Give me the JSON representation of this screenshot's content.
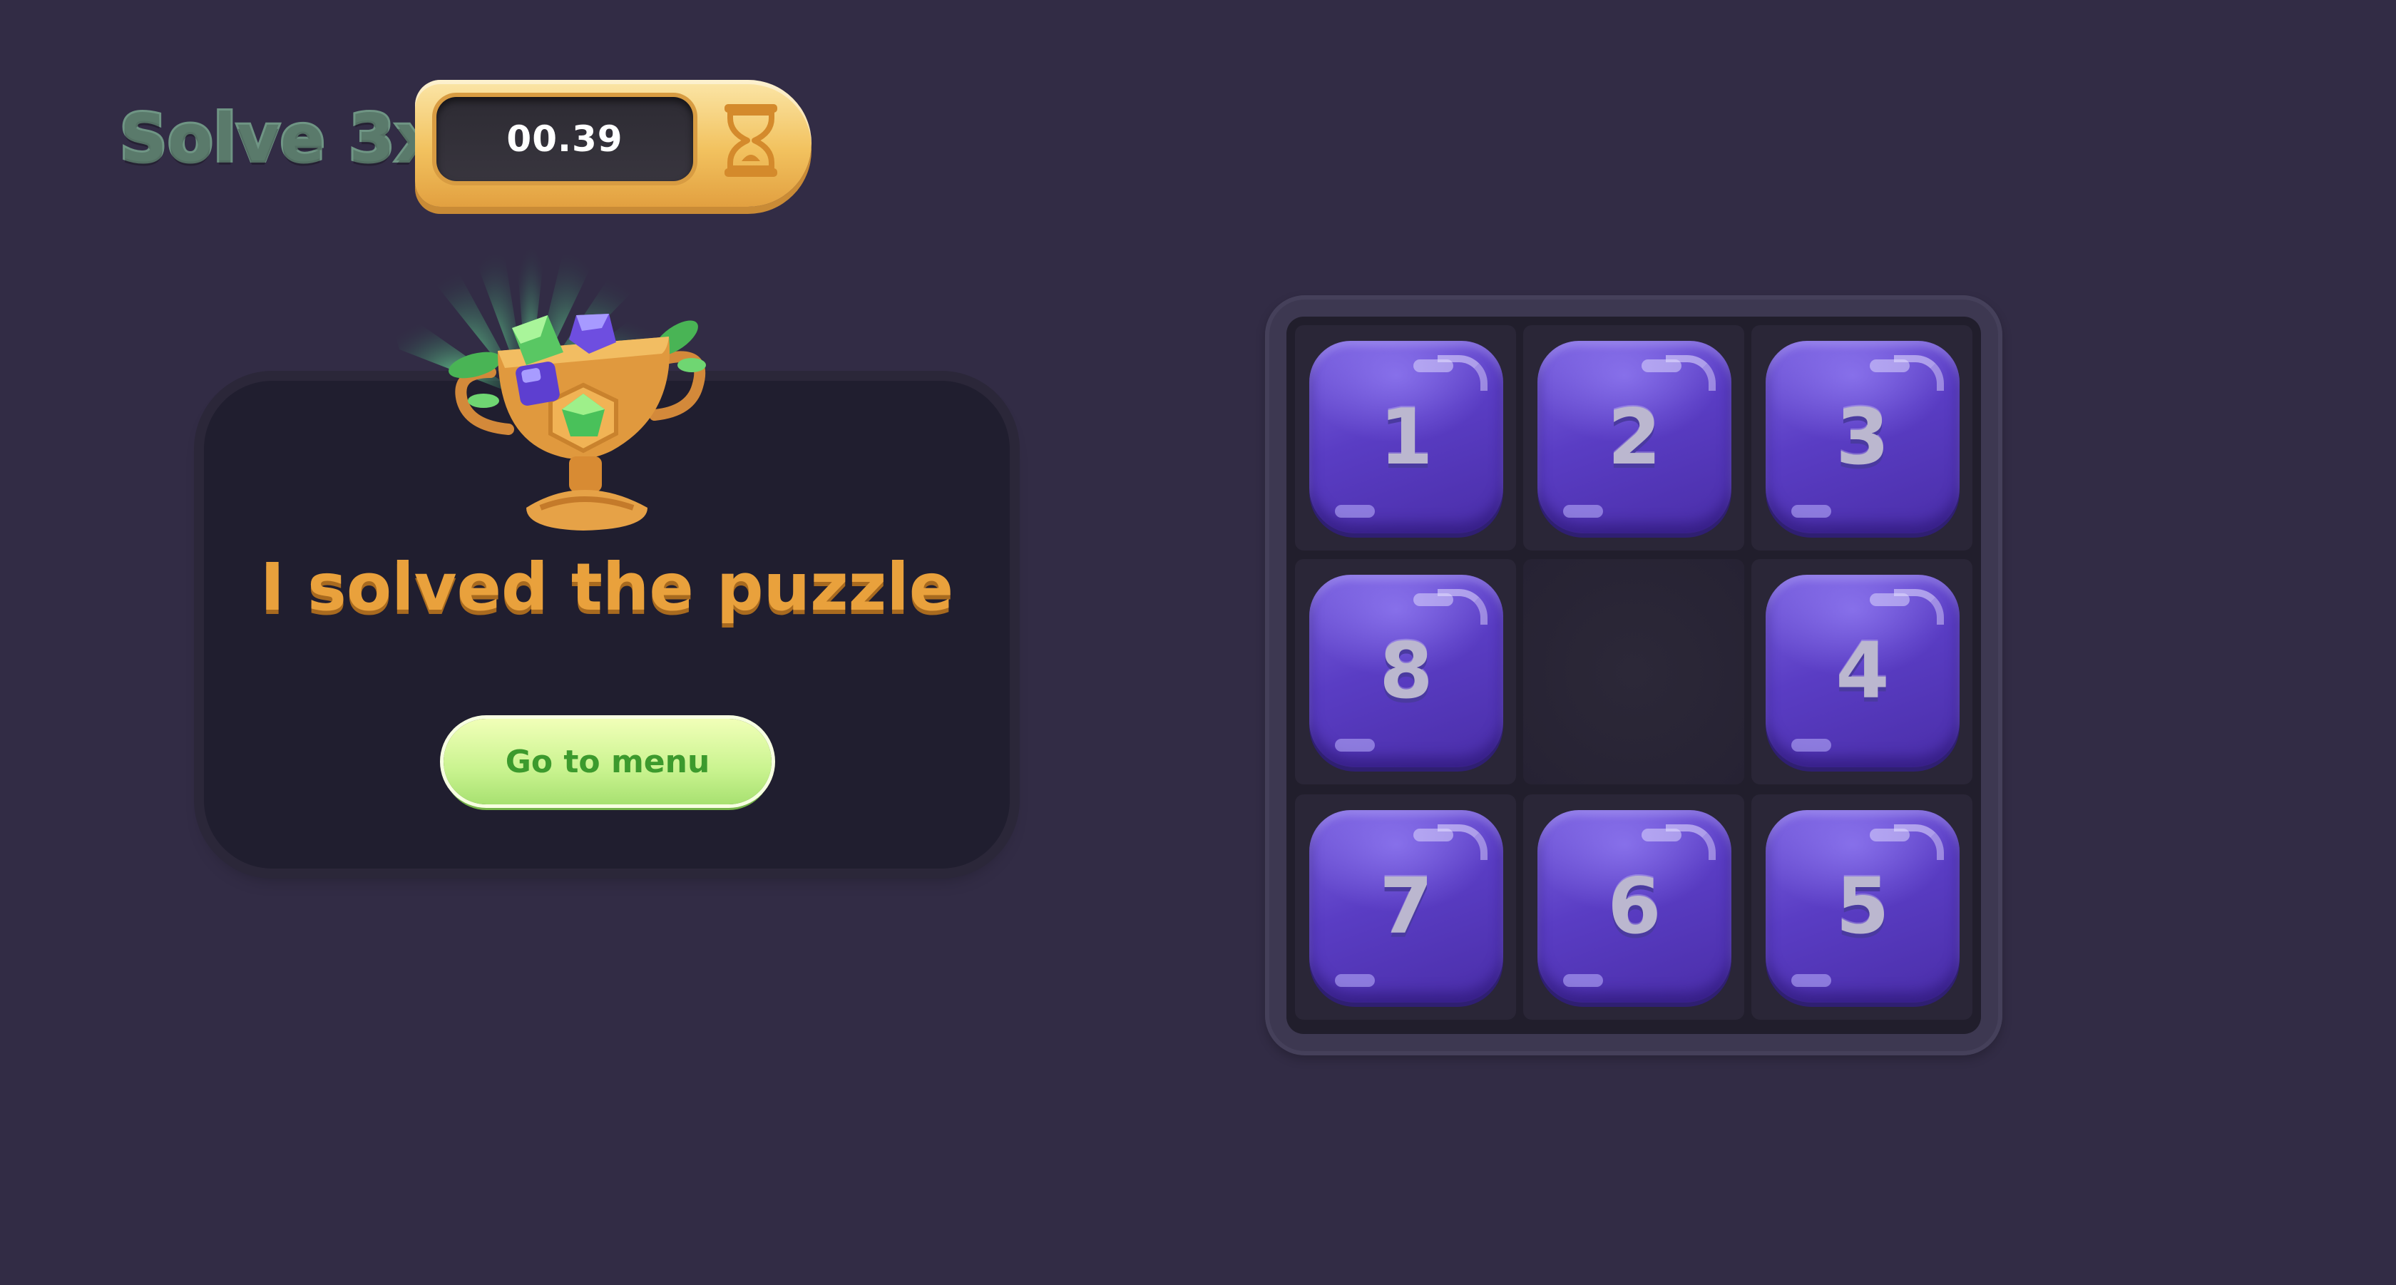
{
  "header": {
    "title": "Solve 3x3",
    "timer": "00.39",
    "timer_icon": "hourglass-icon"
  },
  "result": {
    "trophy_icon": "trophy-icon",
    "title": "I solved the puzzle",
    "menu_button": "Go to menu"
  },
  "board": {
    "size": "3x3",
    "tiles": [
      "1",
      "2",
      "3",
      "8",
      "",
      "4",
      "7",
      "6",
      "5"
    ]
  },
  "colors": {
    "background": "#322c45",
    "panel": "#201e2f",
    "title_orange": "#e9a13c",
    "button_green": "#c9f38f",
    "tile_purple": "#5a3dc4",
    "header_green": "#5a7a6b",
    "timer_gold": "#f2c25f"
  }
}
